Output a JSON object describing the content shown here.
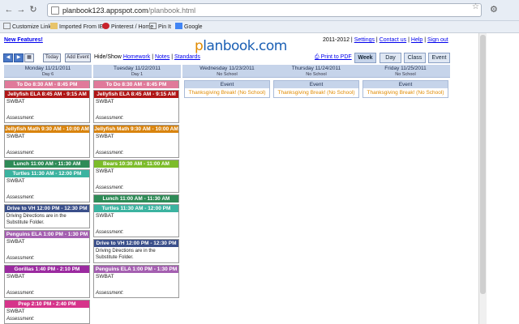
{
  "browser": {
    "url_host": "planbook123.appspot.com",
    "url_path": "/planbook.html",
    "bookmarks": [
      "Customize Links",
      "Imported From IE",
      "Pinterest / Home",
      "Pin It",
      "Google"
    ]
  },
  "header": {
    "new_features": "New Features!",
    "school_year": "2011-2012",
    "links": [
      "Settings",
      "Contact us",
      "Help",
      "Sign out"
    ],
    "logo_prefix": "p",
    "logo_rest": "lanbook.com"
  },
  "toolbar": {
    "today": "Today",
    "add_event": "Add Event",
    "hide_show_label": "Hide/Show",
    "hide_show_links": [
      "Homework",
      "Notes",
      "Standards"
    ],
    "print": "Print to PDF",
    "views": [
      "Week",
      "Day",
      "Class",
      "Event"
    ],
    "active_view": "Week"
  },
  "days": [
    {
      "name": "Monday 11/21/2011",
      "sub": "Day 6"
    },
    {
      "name": "Tuesday 11/22/2011",
      "sub": "Day 1"
    },
    {
      "name": "Wednesday 11/23/2011",
      "sub": "No School"
    },
    {
      "name": "Thursday 11/24/2011",
      "sub": "No School"
    },
    {
      "name": "Friday 11/25/2011",
      "sub": "No School"
    }
  ],
  "events": {
    "label": "Event",
    "text": "Thanksgiving Break! (No School)"
  },
  "lessons": {
    "swbat": "SWBAT",
    "assessment": "Assessment:",
    "driving_note": "Driving Directions are in the Substitute Folder.",
    "monday": [
      {
        "title": "To Do 8:30 AM - 8:45 PM",
        "color": "#e07a9a"
      },
      {
        "title": "Jellyfish ELA 8:45 AM - 9:15 AM",
        "color": "#b01616"
      },
      {
        "title": "Jellyfish Math 9:30 AM - 10:00 AM",
        "color": "#d9840e"
      },
      {
        "title": "Lunch 11:00 AM - 11:30 AM",
        "color": "#2e8b57"
      },
      {
        "title": "Turtles 11:30 AM - 12:00 PM",
        "color": "#3bb3a0"
      },
      {
        "title": "Drive to VH 12:00 PM - 12:30 PM",
        "color": "#3a4f8a"
      },
      {
        "title": "Penguins ELA 1:00 PM - 1:30 PM",
        "color": "#a45fb0"
      },
      {
        "title": "Gorillas 1:40 PM - 2:10 PM",
        "color": "#9b2aa0"
      },
      {
        "title": "Prep 2:10 PM - 2:40 PM",
        "color": "#d6348a"
      }
    ],
    "tuesday": [
      {
        "title": "To Do 8:30 AM - 8:45 PM",
        "color": "#e07a9a"
      },
      {
        "title": "Jellyfish ELA 8:45 AM - 9:15 AM",
        "color": "#b01616"
      },
      {
        "title": "Jellyfish Math 9:30 AM - 10:00 AM",
        "color": "#d9840e"
      },
      {
        "title": "Bears 10:30 AM - 11:00 AM",
        "color": "#7cbc2a"
      },
      {
        "title": "Lunch 11:00 AM - 11:30 AM",
        "color": "#2e8b57"
      },
      {
        "title": "Turtles 11:30 AM - 12:00 PM",
        "color": "#3bb3a0"
      },
      {
        "title": "Drive to VH 12:00 PM - 12:30 PM",
        "color": "#3a4f8a"
      },
      {
        "title": "Penguins ELA 1:00 PM - 1:30 PM",
        "color": "#a45fb0"
      }
    ]
  }
}
